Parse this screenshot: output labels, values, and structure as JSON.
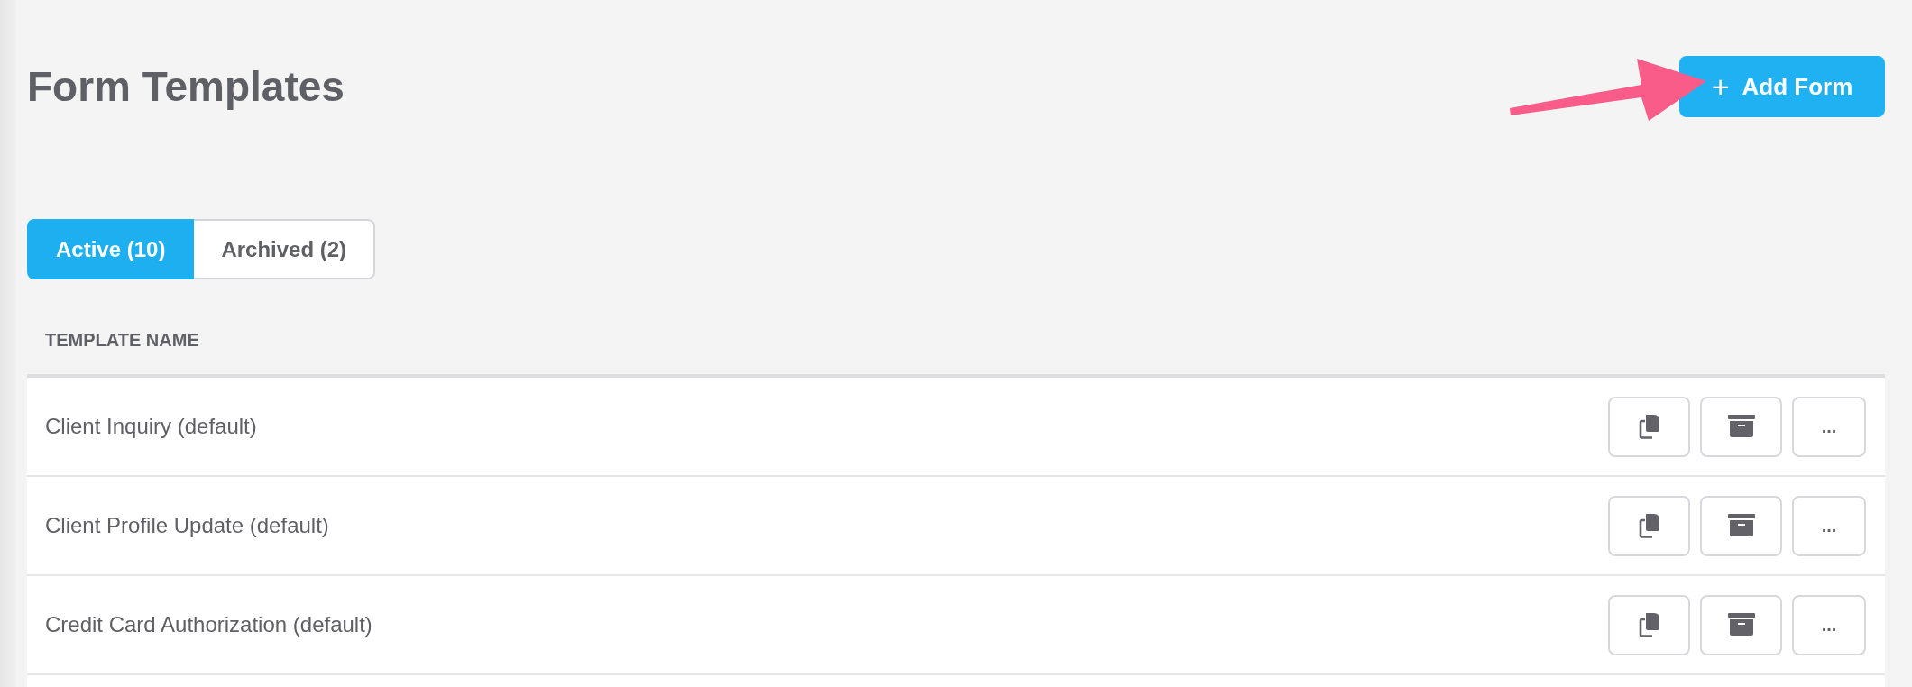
{
  "page": {
    "title": "Form Templates"
  },
  "add_button": {
    "label": "Add Form",
    "icon": "+"
  },
  "tabs": [
    {
      "label": "Active (10)",
      "selected": true
    },
    {
      "label": "Archived (2)",
      "selected": false
    }
  ],
  "table": {
    "columns": [
      "TEMPLATE NAME"
    ],
    "rows": [
      {
        "name": "Client Inquiry (default)",
        "actions": [
          {
            "kind": "copy"
          },
          {
            "kind": "archive"
          },
          {
            "kind": "more",
            "label": "..."
          }
        ]
      },
      {
        "name": "Client Profile Update (default)",
        "actions": [
          {
            "kind": "copy"
          },
          {
            "kind": "archive"
          },
          {
            "kind": "more",
            "label": "..."
          }
        ]
      },
      {
        "name": "Credit Card Authorization (default)",
        "actions": [
          {
            "kind": "copy"
          },
          {
            "kind": "archive"
          },
          {
            "kind": "more",
            "label": "..."
          }
        ]
      }
    ]
  }
}
